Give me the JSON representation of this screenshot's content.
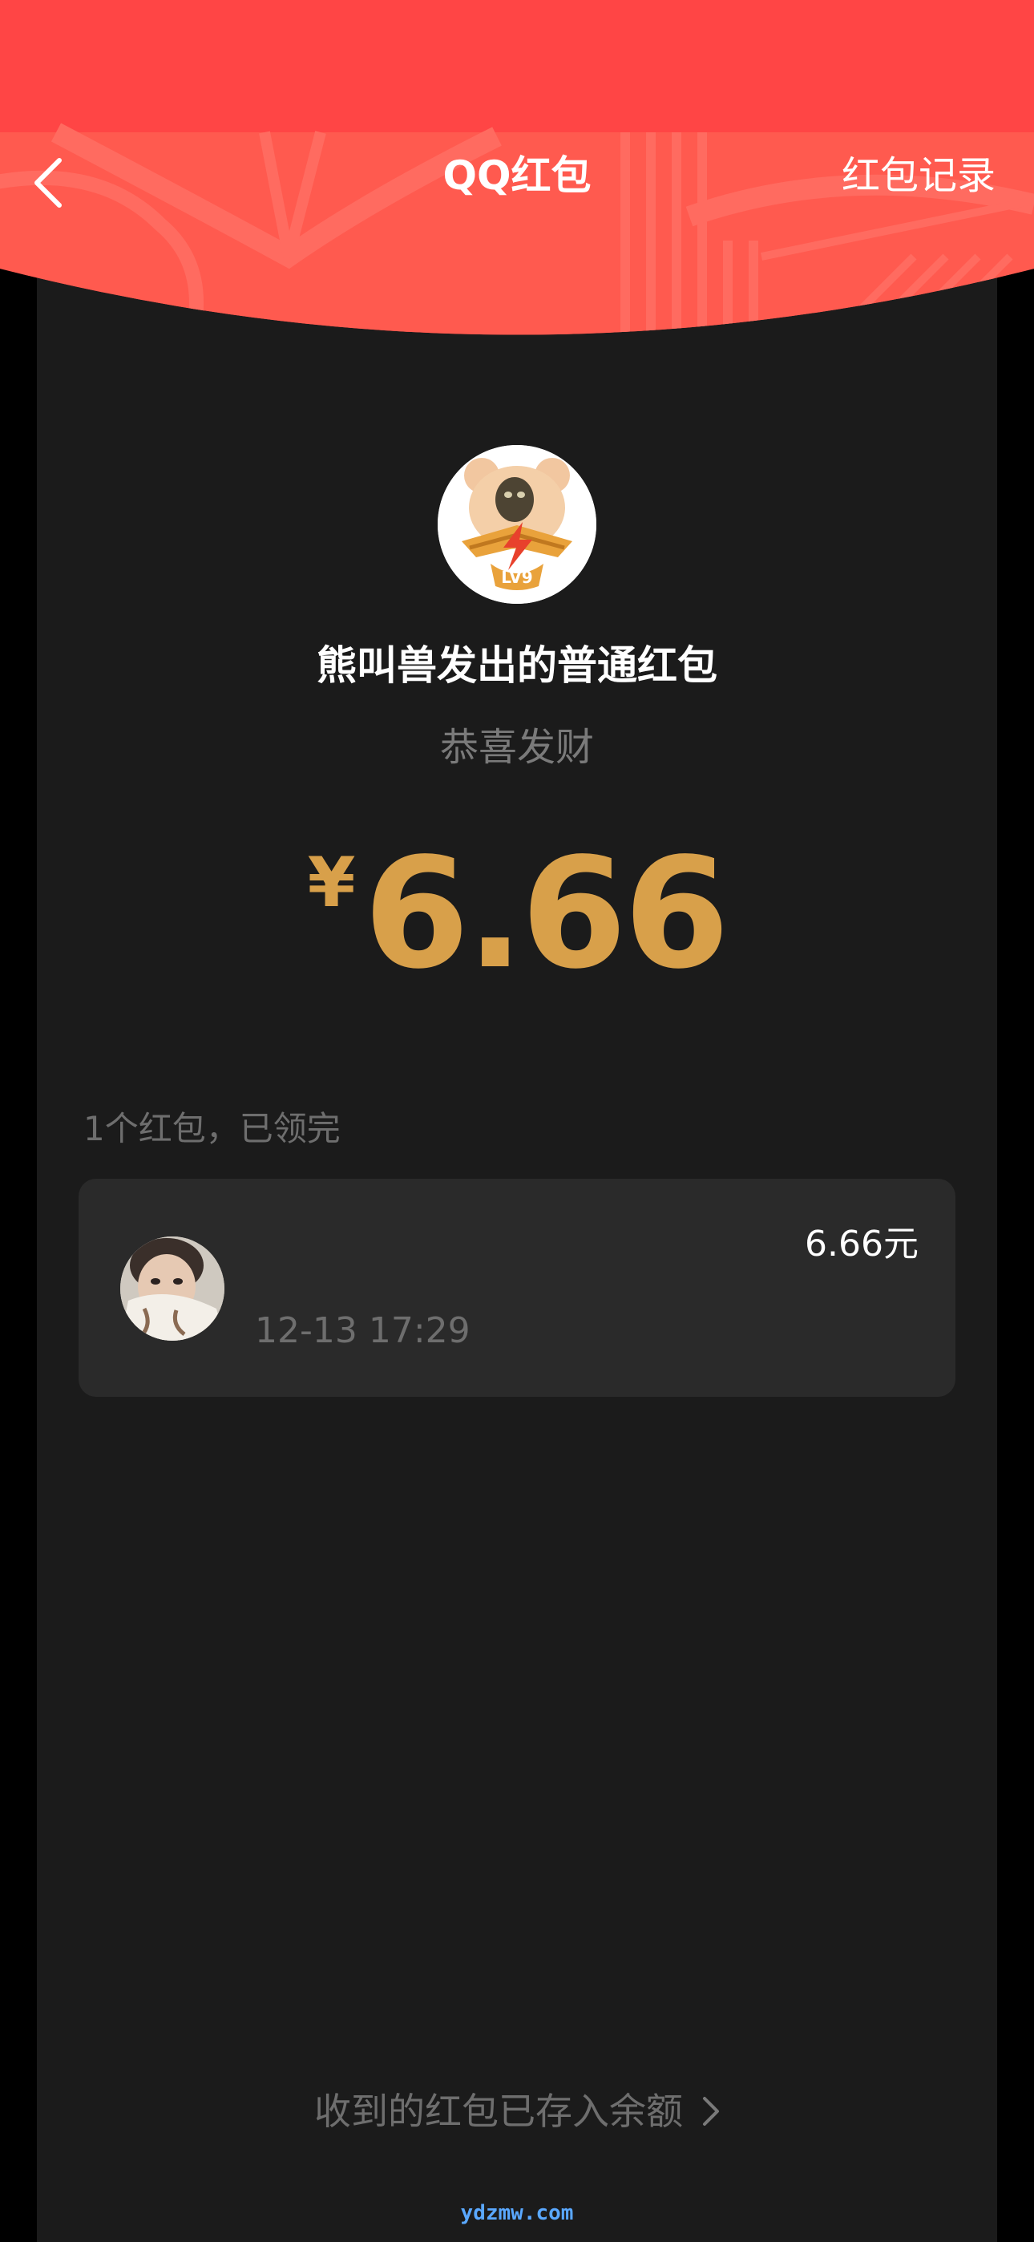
{
  "nav": {
    "back_icon": "chevron-left-icon",
    "title": "QQ红包",
    "record_label": "红包记录"
  },
  "packet": {
    "sender_title": "熊叫兽发出的普通红包",
    "wish": "恭喜发财",
    "currency_symbol": "¥",
    "amount": "6.66",
    "avatar_badge": "LV9"
  },
  "summary": "1个红包，已领完",
  "records": [
    {
      "time": "12-13 17:29",
      "amount": "6.66元"
    }
  ],
  "footer": {
    "link_label": "收到的红包已存入余额",
    "chevron_icon": "chevron-right-icon"
  },
  "watermark": "ydzmw.com",
  "colors": {
    "header_red": "#ff4545",
    "amount_gold": "#d8a04a",
    "panel_bg": "#1b1b1b",
    "card_bg": "#2a2a2a"
  }
}
